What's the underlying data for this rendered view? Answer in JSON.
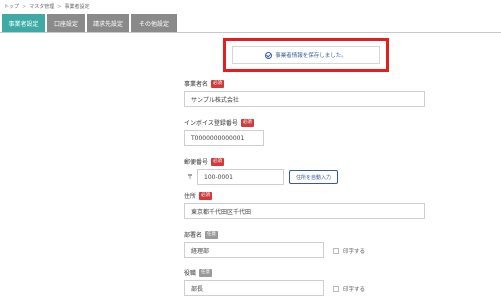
{
  "breadcrumb": [
    "トップ",
    "マスタ管理",
    "事業者設定"
  ],
  "tabs": [
    "事業者設定",
    "口座設定",
    "請求先設定",
    "その他設定"
  ],
  "notice": {
    "message": "事業者情報を保存しました。"
  },
  "fields": {
    "business_name": {
      "label": "事業者名",
      "badge": "必須",
      "value": "サンプル株式会社"
    },
    "invoice_number": {
      "label": "インボイス登録番号",
      "badge": "必須",
      "value": "T0000000000001"
    },
    "postal_code": {
      "label": "郵便番号",
      "badge": "必須",
      "mark": "〒",
      "value": "100-0001",
      "button": "住所を自動入力"
    },
    "address": {
      "label": "住所",
      "badge": "必須",
      "value": "東京都千代田区千代田"
    },
    "department": {
      "label": "部署名",
      "badge": "任意",
      "value": "経理部",
      "print_label": "印字する"
    },
    "position": {
      "label": "役職",
      "badge": "任意",
      "value": "部長",
      "print_label": "印字する"
    }
  }
}
